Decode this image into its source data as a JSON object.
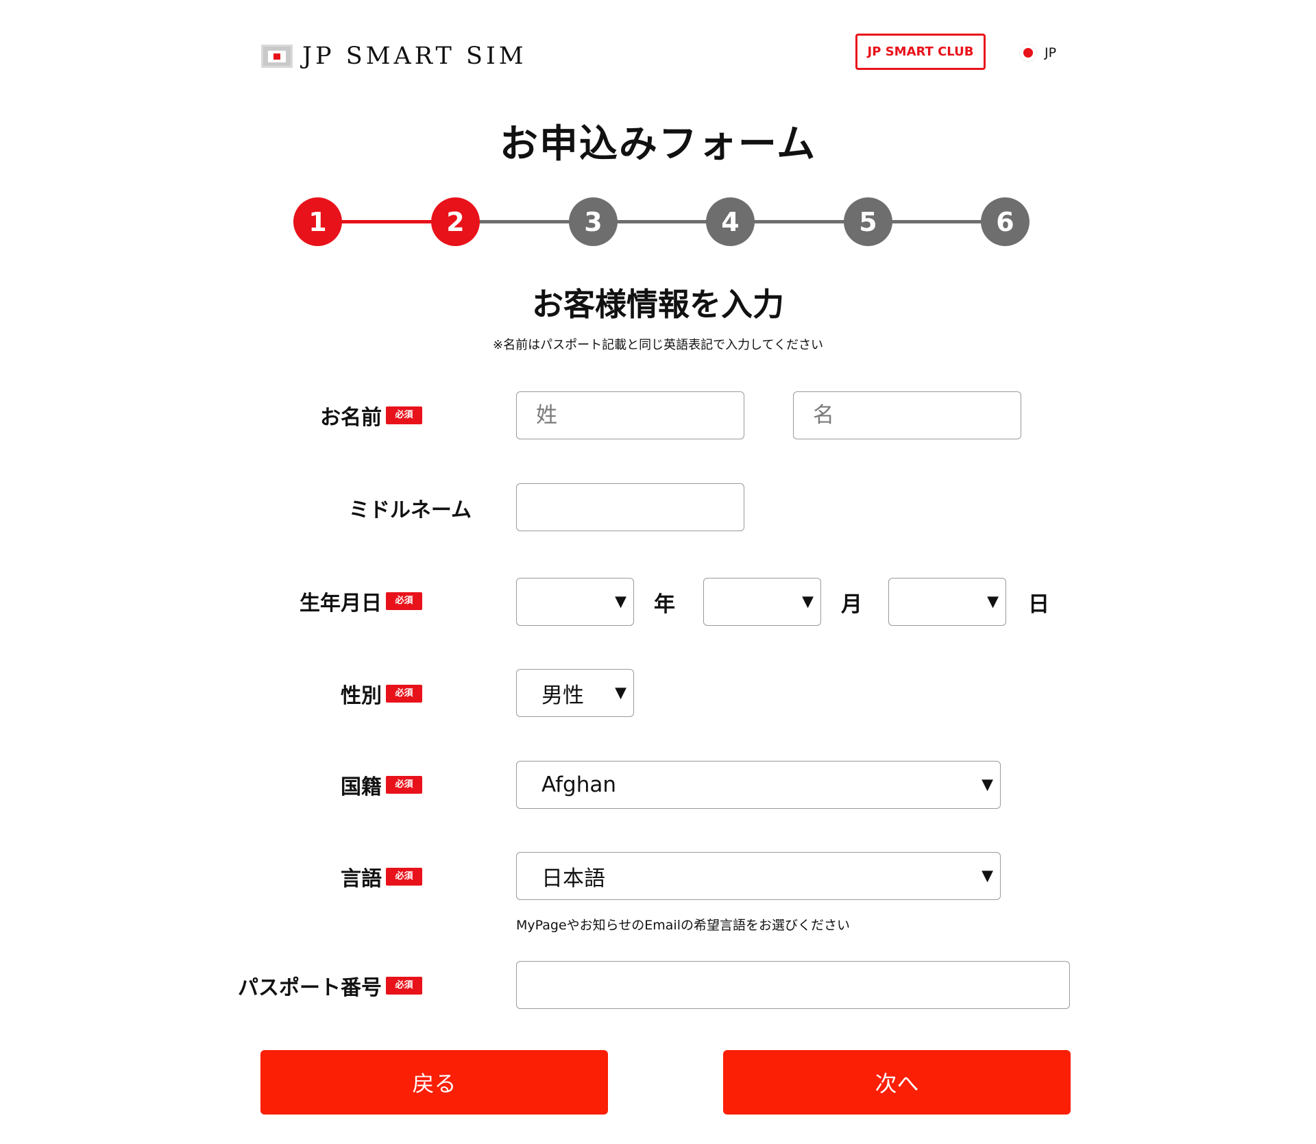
{
  "header": {
    "logo_text": "JP SMART SIM",
    "club_button": "JP SMART CLUB",
    "language": "JP"
  },
  "page_title": "お申込みフォーム",
  "stepper": {
    "steps": [
      "1",
      "2",
      "3",
      "4",
      "5",
      "6"
    ],
    "current_step": 2,
    "active_color": "#e8121a",
    "inactive_color": "#6e6e6e"
  },
  "section": {
    "title": "お客様情報を入力",
    "note": "※名前はパスポート記載と同じ英語表記で入力してください"
  },
  "form": {
    "required_badge": "必須",
    "name": {
      "label": "お名前",
      "last_placeholder": "姓",
      "first_placeholder": "名",
      "last_value": "",
      "first_value": ""
    },
    "middle_name": {
      "label": "ミドルネーム",
      "value": ""
    },
    "birthdate": {
      "label": "生年月日",
      "year_value": "",
      "month_value": "",
      "day_value": "",
      "year_unit": "年",
      "month_unit": "月",
      "day_unit": "日"
    },
    "gender": {
      "label": "性別",
      "value": "男性"
    },
    "nationality": {
      "label": "国籍",
      "value": "Afghan"
    },
    "language": {
      "label": "言語",
      "value": "日本語",
      "help": "MyPageやお知らせのEmailの希望言語をお選びください"
    },
    "passport": {
      "label": "パスポート番号",
      "value": ""
    }
  },
  "buttons": {
    "back": "戻る",
    "next": "次へ",
    "color": "#fa1f05"
  }
}
